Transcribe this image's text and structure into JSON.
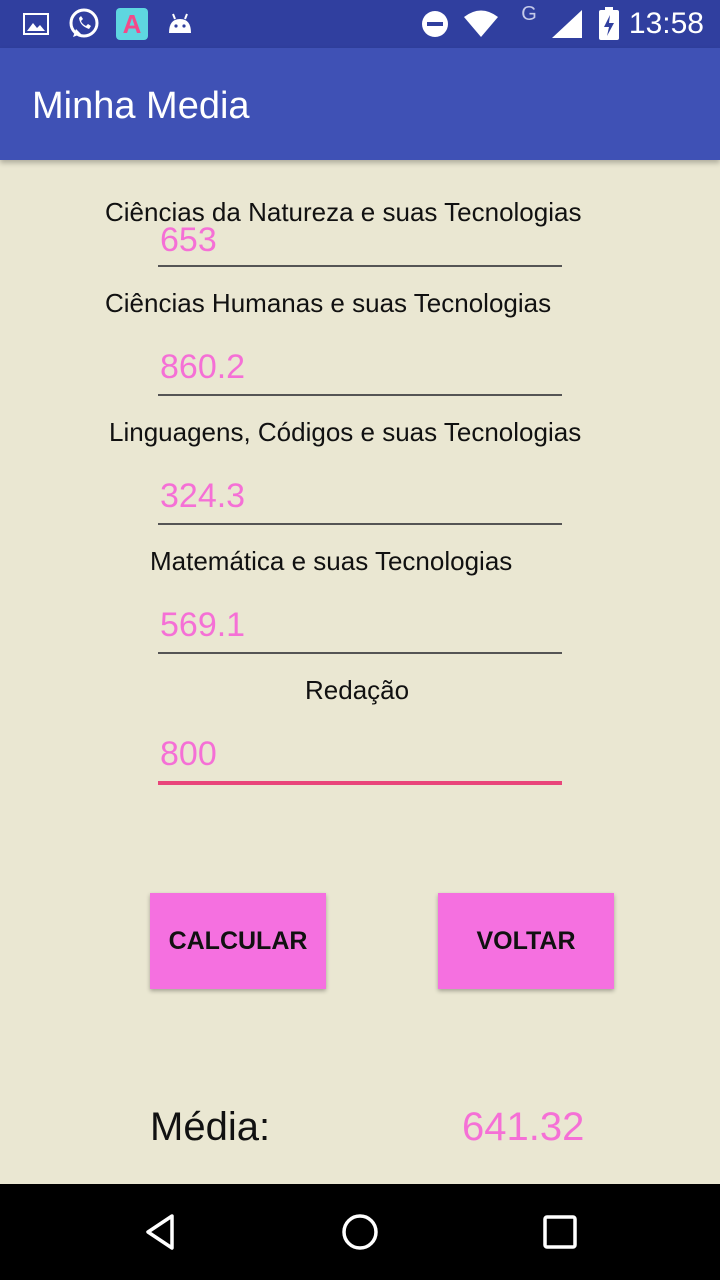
{
  "status_bar": {
    "time": "13:58",
    "left_icons": [
      "gallery-icon",
      "whatsapp-icon",
      "app-icon",
      "android-icon"
    ],
    "right_icons": [
      "do-not-disturb-icon",
      "wifi-icon",
      "network-type-icon",
      "cell-signal-icon",
      "battery-charging-icon"
    ],
    "network_type": "G"
  },
  "app_bar": {
    "title": "Minha Media"
  },
  "form": {
    "fields": [
      {
        "label": "Ciências da Natureza e suas Tecnologias",
        "value": "653"
      },
      {
        "label": "Ciências Humanas e suas Tecnologias",
        "value": "860.2"
      },
      {
        "label": "Linguagens, Códigos e suas Tecnologias",
        "value": "324.3"
      },
      {
        "label": "Matemática e suas Tecnologias",
        "value": "569.1"
      },
      {
        "label": "Redação",
        "value": "800",
        "focused": true
      }
    ]
  },
  "buttons": {
    "calcular": "CALCULAR",
    "voltar": "VOLTAR"
  },
  "result": {
    "label": "Média:",
    "value": "641.32"
  },
  "colors": {
    "status_bar": "#303F9F",
    "app_bar": "#3F51B5",
    "background": "#EAE7D2",
    "accent_pink": "#F570D6",
    "button_pink": "#F570E0",
    "focus_underline": "#E9457A"
  },
  "nav_bar": [
    "back-icon",
    "home-icon",
    "recents-icon"
  ]
}
